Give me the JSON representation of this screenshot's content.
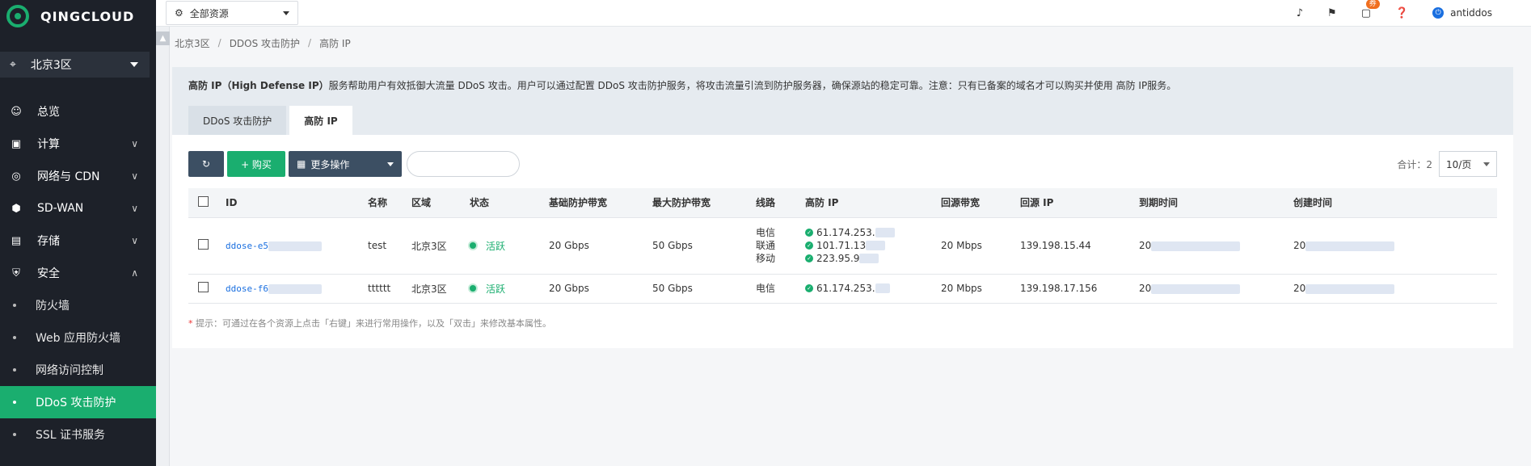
{
  "brand": {
    "name": "QINGCLOUD"
  },
  "region": {
    "current": "北京3区"
  },
  "nav": {
    "items": [
      {
        "label": "总览",
        "icon": "smile-icon"
      },
      {
        "label": "计算",
        "icon": "monitor-icon"
      },
      {
        "label": "网络与 CDN",
        "icon": "globe-icon"
      },
      {
        "label": "SD-WAN",
        "icon": "sdwan-icon"
      },
      {
        "label": "存储",
        "icon": "storage-icon"
      },
      {
        "label": "安全",
        "icon": "shield-icon"
      }
    ],
    "security_sub": [
      {
        "label": "防火墙"
      },
      {
        "label": "Web 应用防火墙"
      },
      {
        "label": "网络访问控制"
      },
      {
        "label": "DDoS 攻击防护"
      },
      {
        "label": "SSL 证书服务"
      }
    ]
  },
  "topbar": {
    "resource_select": "全部资源",
    "coupon_badge": "券",
    "username": "antiddos"
  },
  "breadcrumb": [
    "北京3区",
    "DDOS 攻击防护",
    "高防 IP"
  ],
  "intro": {
    "title_bold": "高防 IP（High Defense IP）",
    "desc": "服务帮助用户有效抵御大流量 DDoS 攻击。用户可以通过配置 DDoS 攻击防护服务，将攻击流量引流到防护服务器，确保源站的稳定可靠。注意：只有已备案的域名才可以购买并使用 高防 IP服务。"
  },
  "tabs": [
    {
      "label": "DDoS 攻击防护",
      "active": false
    },
    {
      "label": "高防 IP",
      "active": true
    }
  ],
  "toolbar": {
    "buy_label": "+ 购买",
    "more_label": "更多操作",
    "search_placeholder": "",
    "total": "合计：2",
    "page_size": "10/页"
  },
  "table": {
    "headers": [
      "ID",
      "名称",
      "区域",
      "状态",
      "基础防护带宽",
      "最大防护带宽",
      "线路",
      "高防 IP",
      "回源带宽",
      "回源 IP",
      "到期时间",
      "创建时间"
    ],
    "rows": [
      {
        "id": "ddose-e5",
        "name": "test",
        "region": "北京3区",
        "status": "活跃",
        "base_bw": "20 Gbps",
        "max_bw": "50 Gbps",
        "lines": [
          "电信",
          "联通",
          "移动"
        ],
        "ips": [
          "61.174.253.",
          "101.71.13",
          "223.95.9"
        ],
        "return_bw": "20 Mbps",
        "return_ip": "139.198.15.44",
        "expire": "20",
        "created": "20"
      },
      {
        "id": "ddose-f6",
        "name": "tttttt",
        "region": "北京3区",
        "status": "活跃",
        "base_bw": "20 Gbps",
        "max_bw": "50 Gbps",
        "lines": [
          "电信"
        ],
        "ips": [
          "61.174.253."
        ],
        "return_bw": "20 Mbps",
        "return_ip": "139.198.17.156",
        "expire": "20",
        "created": "20"
      }
    ]
  },
  "hint": {
    "star": "*",
    "text": "提示：可通过在各个资源上点击「右键」来进行常用操作，以及「双击」来修改基本属性。"
  },
  "colors": {
    "accent": "#1aae6f",
    "sidebar": "#1d2129",
    "link": "#1a6fe0",
    "dark_button": "#3c4f63"
  }
}
